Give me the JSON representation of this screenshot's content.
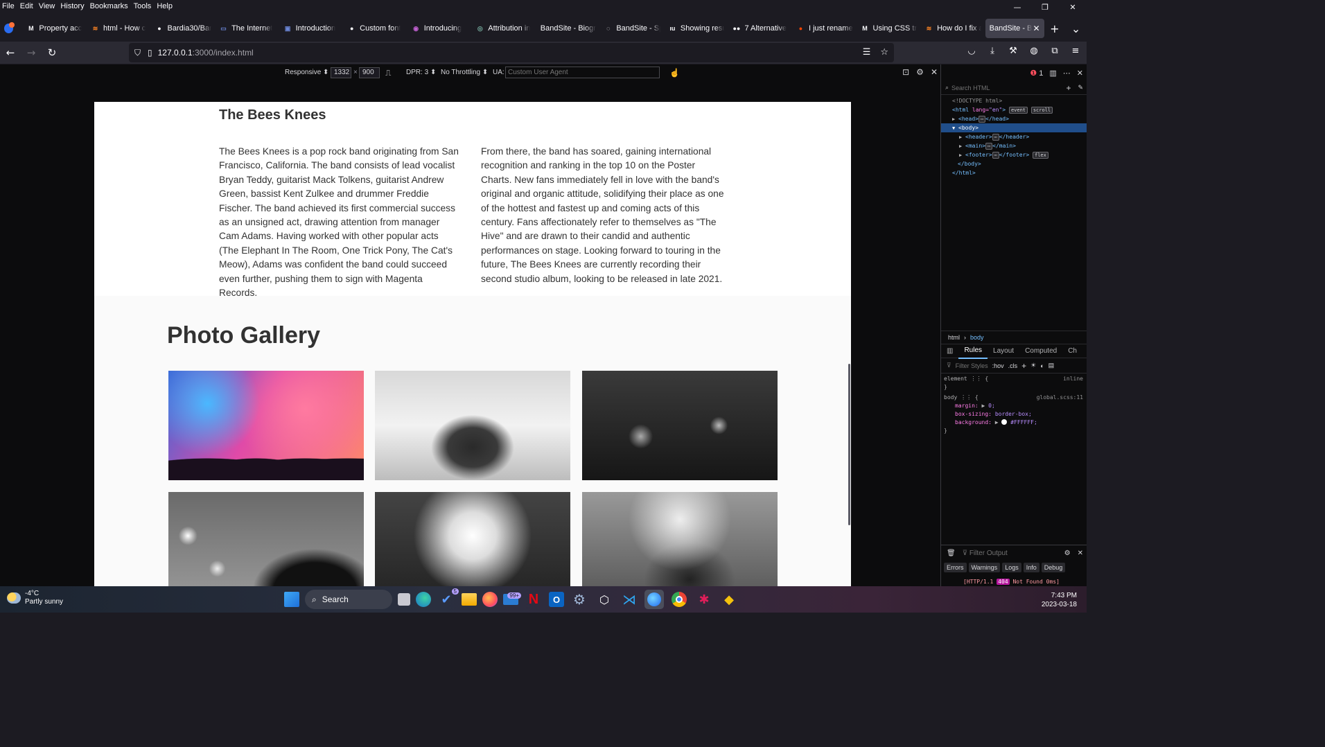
{
  "menubar": {
    "items": [
      "File",
      "Edit",
      "View",
      "History",
      "Bookmarks",
      "Tools",
      "Help"
    ]
  },
  "tabs": [
    {
      "label": "Property acc",
      "icon": "M"
    },
    {
      "label": "html - How c",
      "icon": "≋"
    },
    {
      "label": "Bardia30/Bar",
      "icon": "●"
    },
    {
      "label": "The Internet",
      "icon": "▭"
    },
    {
      "label": "Introduction",
      "icon": "▣"
    },
    {
      "label": "Custom font",
      "icon": "●"
    },
    {
      "label": "Introducing",
      "icon": "◉"
    },
    {
      "label": "Attribution in",
      "icon": "◎"
    },
    {
      "label": "BandSite - Biogra",
      "icon": ""
    },
    {
      "label": "BandSite - Sp",
      "icon": "◌"
    },
    {
      "label": "Showing resu",
      "icon": "ıu"
    },
    {
      "label": "7 Alternative",
      "icon": "●●"
    },
    {
      "label": "I just rename",
      "icon": "●"
    },
    {
      "label": "Using CSS tra",
      "icon": "M"
    },
    {
      "label": "How do I fix a",
      "icon": "≋"
    },
    {
      "label": "BandSite - Bio",
      "icon": "",
      "active": true
    }
  ],
  "url": {
    "host": "127.0.0.1",
    "rest": ":3000/index.html"
  },
  "rdm": {
    "device": "Responsive",
    "width": "1332",
    "height": "900",
    "dpr": "DPR: 3",
    "throttling": "No Throttling",
    "ua_label": "UA:",
    "ua_placeholder": "Custom User Agent"
  },
  "bio": {
    "title": "The Bees Knees",
    "col1": "The Bees Knees is a pop rock band originating from San Francisco, California. The band consists of lead vocalist Bryan Teddy, guitarist Mack Tolkens, guitarist Andrew Green, bassist Kent Zulkee and drummer Freddie Fischer. The band achieved its first commercial success as an unsigned act, drawing attention from manager Cam Adams. Having worked with other popular acts (The Elephant In The Room, One Trick Pony, The Cat's Meow), Adams was confident the band could succeed even further, pushing them to sign with Magenta Records.",
    "col2": "From there, the band has soared, gaining international recognition and ranking in the top 10 on the Poster Charts. New fans immediately fell in love with the band's original and organic attitude, solidifying their place as one of the hottest and fastest up and coming acts of this century. Fans affectionately refer to themselves as \"The Hive\" and are drawn to their candid and authentic performances on stage. Looking forward to touring in the future, The Bees Knees are currently recording their second studio album, looking to be released in late 2021."
  },
  "gallery": {
    "title": "Photo Gallery"
  },
  "devtools": {
    "search_placeholder": "Search HTML",
    "doctype": "<!DOCTYPE html>",
    "html_open": "html",
    "lang_attr": "lang=",
    "lang_val": "\"en\"",
    "badge_event": "event",
    "badge_scroll": "scroll",
    "head": "<head>",
    "head_close": "</head>",
    "body": "<body>",
    "header": "<header>",
    "header_close": "</header>",
    "main": "<main>",
    "main_close": "</main>",
    "footer": "<footer>",
    "footer_close": "</footer>",
    "badge_flex": "flex",
    "body_close": "</body>",
    "html_close": "</html>",
    "breadcrumb": [
      "html",
      "body"
    ],
    "panel_tabs": [
      "Rules",
      "Layout",
      "Computed",
      "Ch"
    ],
    "filter_placeholder": "Filter Styles",
    "hov": ":hov",
    "cls": ".cls",
    "rule_element": "element",
    "rule_inline": "inline",
    "rule_body": "body",
    "rule_src": "global.scss:11",
    "decl_margin_prop": "margin:",
    "decl_margin_val": "0;",
    "decl_box_prop": "box-sizing:",
    "decl_box_val": "border-box;",
    "decl_bg_prop": "background:",
    "decl_bg_val": "#FFFFFF;",
    "console_filter": "Filter Output",
    "console_tabs": [
      "Errors",
      "Warnings",
      "Logs",
      "Info",
      "Debug"
    ],
    "console_err_prefix": "[HTTP/1.1",
    "console_err_code": "404",
    "console_err_suffix": "Not Found 0ms]",
    "error_count": "1"
  },
  "taskbar": {
    "temp": "-4°C",
    "weather": "Partly sunny",
    "search": "Search",
    "todo_badge": "5",
    "mail_badge": "99+",
    "time": "7:43 PM",
    "date": "2023-03-18"
  },
  "colors": {
    "accent": "#0060df",
    "page_text": "#323232"
  }
}
